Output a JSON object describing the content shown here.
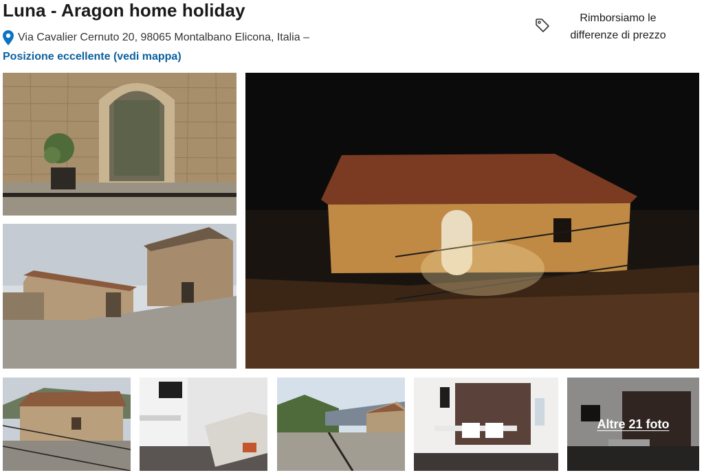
{
  "property": {
    "title": "Luna - Aragon home holiday",
    "address": "Via Cavalier Cernuto 20, 98065 Montalbano Elicona, Italia –",
    "map_link": "Posizione eccellente (vedi mappa)"
  },
  "price_match": {
    "text_line1": "Rimborsiamo le",
    "text_line2": "differenze di prezzo",
    "icon": "tag-icon"
  },
  "gallery": {
    "more_photos_label": "Altre 21 foto",
    "photos": [
      {
        "name": "arched-doorway-photo"
      },
      {
        "name": "village-street-photo"
      },
      {
        "name": "house-at-night-photo"
      },
      {
        "name": "house-exterior-photo"
      },
      {
        "name": "kitchen-photo"
      },
      {
        "name": "hillside-view-photo"
      },
      {
        "name": "dining-room-photo"
      },
      {
        "name": "living-room-photo"
      }
    ]
  },
  "colors": {
    "link": "#0a5f9e",
    "pin": "#0a74c4",
    "text": "#1a1a1a"
  }
}
